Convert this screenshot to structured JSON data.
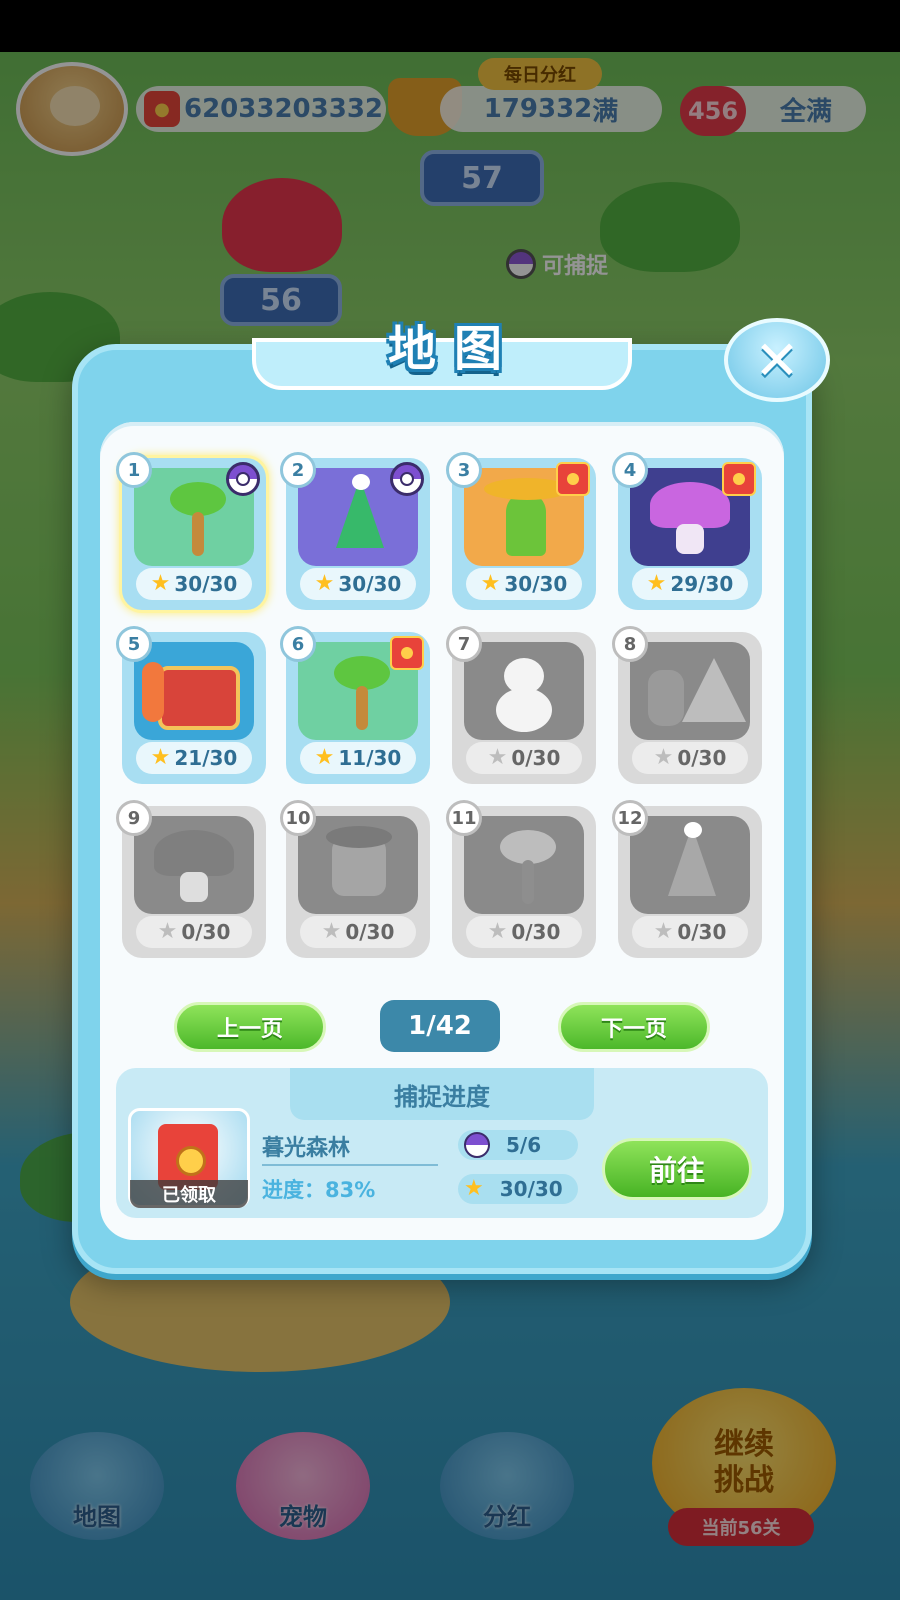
{
  "hud": {
    "coins": "62033203332",
    "dividend_tag": "每日分红",
    "trophy_value": "179332",
    "trophy_status": "满",
    "hearts": "456",
    "hearts_status": "全满",
    "level_57": "57",
    "level_56": "56",
    "catchable": "可捕捉"
  },
  "modal": {
    "title_chars": [
      "地",
      "图"
    ],
    "close_symbol": "✕"
  },
  "maps": [
    {
      "num": "1",
      "stars": "30/30",
      "art": "palm-icon",
      "badge": "ball",
      "locked": false,
      "selected": true
    },
    {
      "num": "2",
      "stars": "30/30",
      "art": "tree-icon",
      "badge": "ball",
      "locked": false,
      "selected": false
    },
    {
      "num": "3",
      "stars": "30/30",
      "art": "cactus-icon",
      "badge": "envelope",
      "locked": false,
      "selected": false
    },
    {
      "num": "4",
      "stars": "29/30",
      "art": "mushroom-icon",
      "badge": "envelope",
      "locked": false,
      "selected": false
    },
    {
      "num": "5",
      "stars": "21/30",
      "art": "chest-icon",
      "badge": "",
      "locked": false,
      "selected": false
    },
    {
      "num": "6",
      "stars": "11/30",
      "art": "palm-icon",
      "badge": "envelope",
      "locked": false,
      "selected": false
    },
    {
      "num": "7",
      "stars": "0/30",
      "art": "snowman-icon",
      "badge": "",
      "locked": true,
      "selected": false
    },
    {
      "num": "8",
      "stars": "0/30",
      "art": "pyramid-icon",
      "badge": "",
      "locked": true,
      "selected": false
    },
    {
      "num": "9",
      "stars": "0/30",
      "art": "mushroom-icon",
      "badge": "",
      "locked": true,
      "selected": false
    },
    {
      "num": "10",
      "stars": "0/30",
      "art": "house-icon",
      "badge": "",
      "locked": true,
      "selected": false
    },
    {
      "num": "11",
      "stars": "0/30",
      "art": "palm-icon",
      "badge": "",
      "locked": true,
      "selected": false
    },
    {
      "num": "12",
      "stars": "0/30",
      "art": "tree-icon",
      "badge": "",
      "locked": true,
      "selected": false
    }
  ],
  "pagination": {
    "prev": "上一页",
    "current": "1/42",
    "next": "下一页"
  },
  "capture": {
    "header": "捕捉进度",
    "reward_status": "已领取",
    "area_name": "暮光森林",
    "progress": "进度：83%",
    "pets": "5/6",
    "stars": "30/30",
    "go": "前往"
  },
  "bottom_nav": {
    "map": "地图",
    "pets": "宠物",
    "dividend": "分红",
    "continue_line1": "继续",
    "continue_line2": "挑战",
    "current_level": "当前56关"
  },
  "colors": {
    "modal_bg": "#7fd3ec",
    "button_green": "#4cb82a",
    "star_gold": "#ffbf1f",
    "envelope_red": "#e8433a"
  }
}
